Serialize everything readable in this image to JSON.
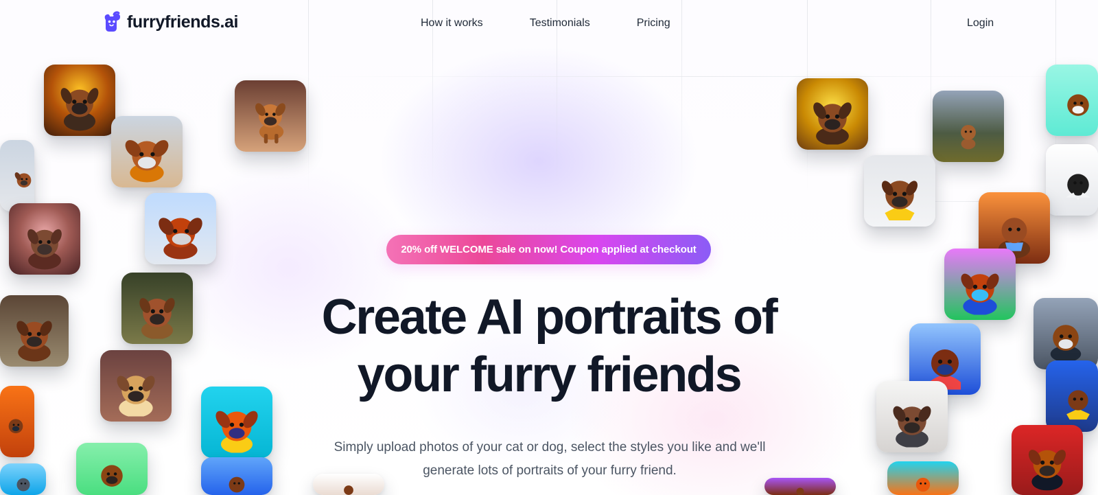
{
  "brand": {
    "name": "furryfriends.ai",
    "accent": "#5b4bff"
  },
  "nav": {
    "items": [
      {
        "label": "How it works"
      },
      {
        "label": "Testimonials"
      },
      {
        "label": "Pricing"
      }
    ],
    "login": "Login"
  },
  "hero": {
    "promo": "20% off WELCOME sale on now! Coupon applied at checkout",
    "headline": [
      "Create AI portraits of",
      "your furry friends"
    ],
    "subheadline": [
      "Simply upload photos of your cat or dog, select the styles you like and we'll",
      "generate lots of portraits of your furry friend."
    ]
  },
  "colors": {
    "promo_gradient": [
      "#f472b6",
      "#d946ef",
      "#8b5cf6"
    ],
    "heading": "#111827",
    "body_text": "#4b5563"
  }
}
